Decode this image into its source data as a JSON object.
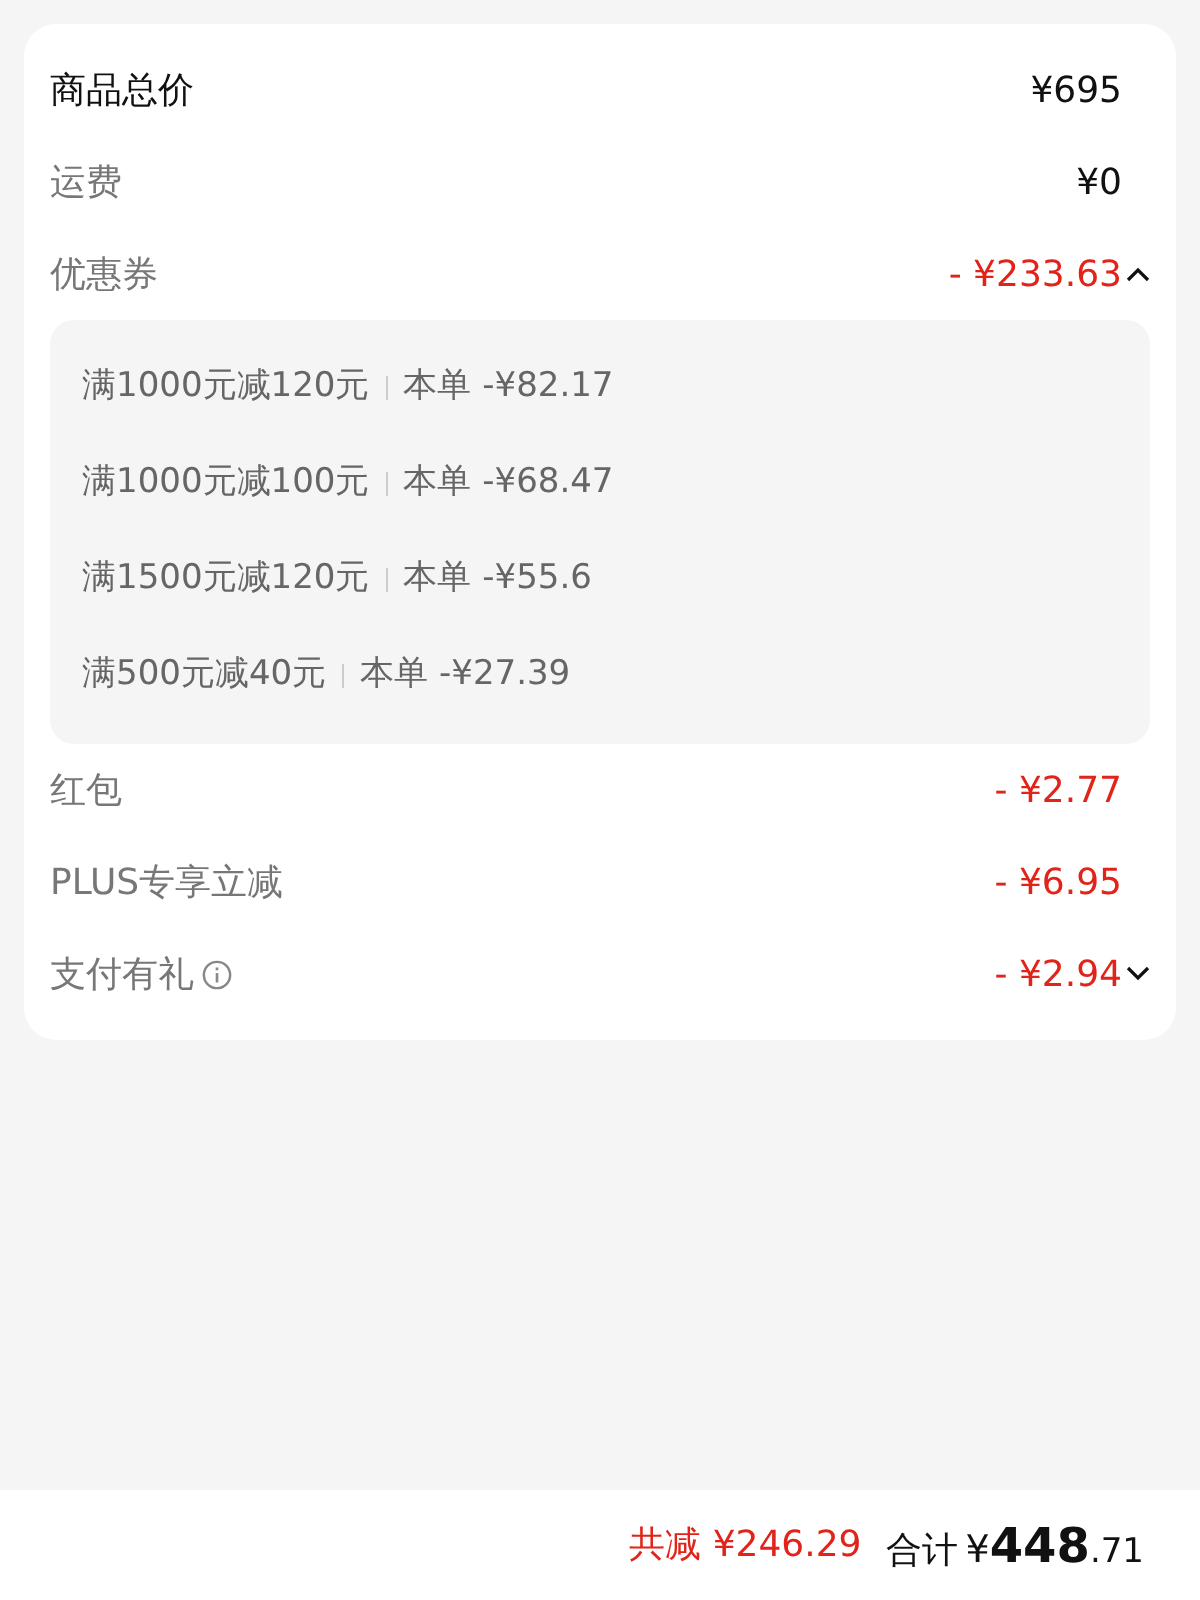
{
  "rows": [
    {
      "kind": "total",
      "label": "商品总价",
      "value": "¥695"
    },
    {
      "kind": "plain",
      "label": "运费",
      "value": "¥0"
    },
    {
      "kind": "discount",
      "label": "优惠券",
      "value": "- ¥233.63",
      "expanded": true,
      "coupons": [
        {
          "rule": "满1000元减120元",
          "amount": "本单 -¥82.17"
        },
        {
          "rule": "满1000元减100元",
          "amount": "本单 -¥68.47"
        },
        {
          "rule": "满1500元减120元",
          "amount": "本单 -¥55.6"
        },
        {
          "rule": "满500元减40元",
          "amount": "本单 -¥27.39"
        }
      ]
    },
    {
      "kind": "discount",
      "label": "红包",
      "value": "- ¥2.77"
    },
    {
      "kind": "discount",
      "label": "PLUS专享立减",
      "value": "- ¥6.95"
    },
    {
      "kind": "discount",
      "label": "支付有礼",
      "value": "- ¥2.94",
      "info": true,
      "expanded": false
    }
  ],
  "footer": {
    "saved": "共减 ¥246.29",
    "total_label": "合计",
    "currency": "¥",
    "integer": "448",
    "decimal": ".71"
  }
}
